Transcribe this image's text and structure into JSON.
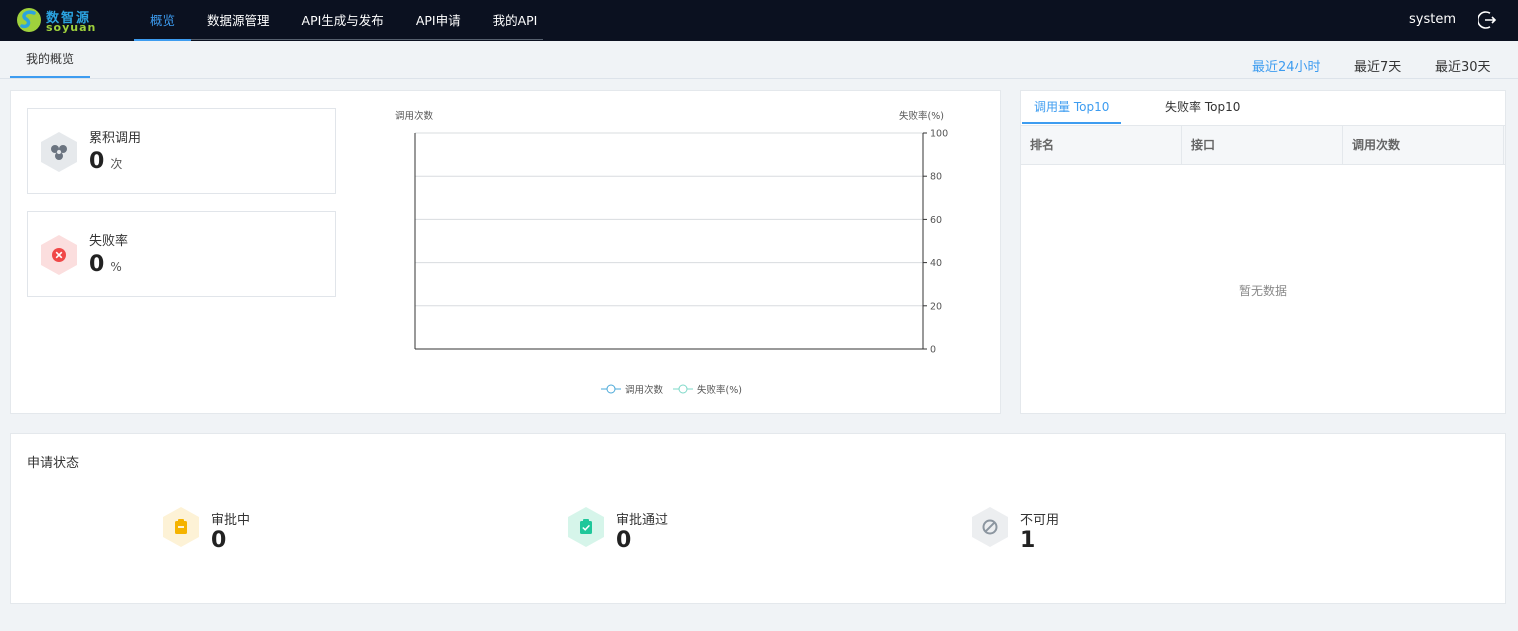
{
  "brand": {
    "name_cn": "数智源",
    "name_en": "soyuan",
    "colors": {
      "blue": "#2ba3e0",
      "green": "#9fd13c"
    }
  },
  "nav": [
    {
      "label": "概览",
      "active": true
    },
    {
      "label": "数据源管理"
    },
    {
      "label": "API生成与发布"
    },
    {
      "label": "API申请"
    },
    {
      "label": "我的API"
    }
  ],
  "user": {
    "name": "system",
    "logout_icon": "logout-icon"
  },
  "subtab": {
    "label": "我的概览"
  },
  "ranges": [
    {
      "label": "最近24小时",
      "active": true
    },
    {
      "label": "最近7天"
    },
    {
      "label": "最近30天"
    }
  ],
  "stats": {
    "calls": {
      "label": "累积调用",
      "value": "0",
      "unit": "次",
      "icon": "api-call-icon"
    },
    "failure": {
      "label": "失败率",
      "value": "0",
      "unit": "%",
      "icon": "failure-icon"
    }
  },
  "chart_data": {
    "type": "line",
    "ylabel_left": "调用次数",
    "ylabel_right": "失败率(%)",
    "y_right_ticks": [
      "100",
      "80",
      "60",
      "40",
      "20",
      "0"
    ],
    "ylim_right": [
      0,
      100
    ],
    "grid": true,
    "legend_position": "bottom",
    "series": [
      {
        "name": "调用次数",
        "values": [],
        "color": "#4aa8d8"
      },
      {
        "name": "失败率(%)",
        "values": [],
        "color": "#7dd8c8"
      }
    ]
  },
  "top10": {
    "tabs": [
      {
        "label": "调用量 Top10",
        "active": true
      },
      {
        "label": "失败率 Top10"
      }
    ],
    "columns": [
      "排名",
      "接口",
      "调用次数"
    ],
    "empty_text": "暂无数据"
  },
  "status": {
    "title": "申请状态",
    "items": [
      {
        "label": "审批中",
        "value": "0",
        "icon": "clipboard-pending-icon",
        "color": "#f5b300",
        "bg": "#fdf2d6"
      },
      {
        "label": "审批通过",
        "value": "0",
        "icon": "clipboard-check-icon",
        "color": "#1fc79a",
        "bg": "#d6f5ea"
      },
      {
        "label": "不可用",
        "value": "1",
        "icon": "disabled-icon",
        "color": "#8c96a0",
        "bg": "#eceef0"
      }
    ]
  }
}
